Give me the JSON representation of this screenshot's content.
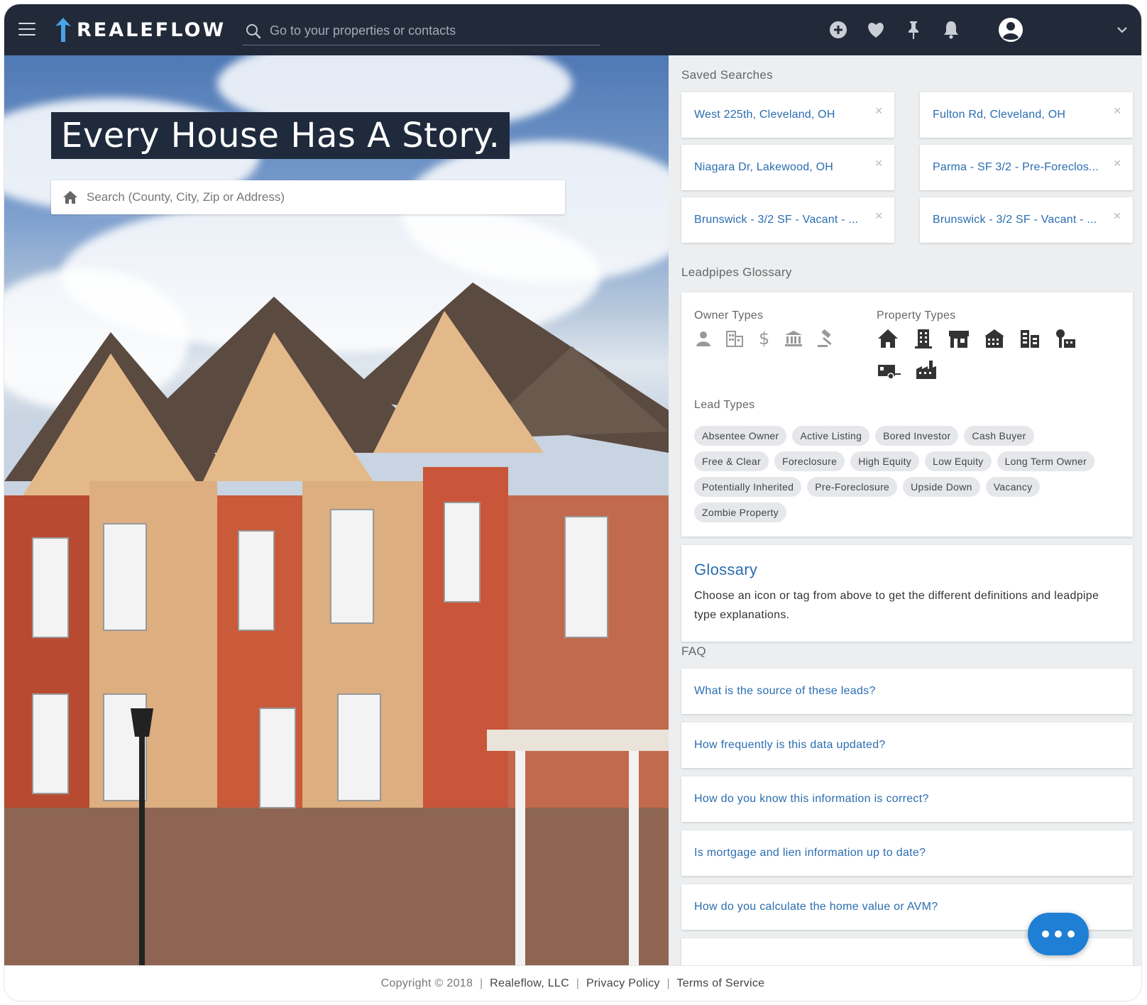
{
  "header": {
    "brand": "REALEFLOW",
    "search_placeholder": "Go to your properties or contacts",
    "icons": [
      "add-circle-icon",
      "heart-icon",
      "pin-icon",
      "bell-icon",
      "account-circle-icon",
      "chevron-down-icon"
    ]
  },
  "hero": {
    "title": "Every House Has A Story.",
    "search_placeholder": "Search (County, City, Zip or Address)"
  },
  "saved_searches": {
    "label": "Saved Searches",
    "items": [
      "West 225th, Cleveland, OH",
      "Fulton Rd, Cleveland, OH",
      "Niagara Dr, Lakewood, OH",
      "Parma - SF 3/2 - Pre-Foreclos...",
      "Brunswick - 3/2 SF - Vacant - ...",
      "Brunswick - 3/2 SF - Vacant - ..."
    ]
  },
  "glossary": {
    "label": "Leadpipes Glossary",
    "owner_types_label": "Owner Types",
    "owner_type_icons": [
      "person-icon",
      "company-icon",
      "dollar-icon",
      "bank-icon",
      "gavel-icon"
    ],
    "property_types_label": "Property Types",
    "property_type_icons": [
      "house-icon",
      "apartment-icon",
      "storefront-icon",
      "townhouse-icon",
      "office-building-icon",
      "land-icon",
      "mobile-home-icon",
      "factory-icon"
    ],
    "lead_types_label": "Lead Types",
    "lead_types": [
      "Absentee Owner",
      "Active Listing",
      "Bored Investor",
      "Cash Buyer",
      "Free & Clear",
      "Foreclosure",
      "High Equity",
      "Low Equity",
      "Long Term Owner",
      "Potentially Inherited",
      "Pre-Foreclosure",
      "Upside Down",
      "Vacancy",
      "Zombie Property"
    ],
    "definition_title": "Glossary",
    "definition_text": "Choose an icon or tag from above to get the different definitions and leadpipe type explanations."
  },
  "faq": {
    "label": "FAQ",
    "items": [
      "What is the source of these leads?",
      "How frequently is this data updated?",
      "How do you know this information is correct?",
      "Is mortgage and lien information up to date?",
      "How do you calculate the home value or AVM?"
    ]
  },
  "footer": {
    "copyright": "Copyright © 2018",
    "company": "Realeflow, LLC",
    "privacy": "Privacy Policy",
    "terms": "Terms of Service",
    "separator": "|"
  },
  "colors": {
    "topbar": "#222a3a",
    "link": "#2a6db0",
    "chat_button": "#1e7fd4"
  }
}
